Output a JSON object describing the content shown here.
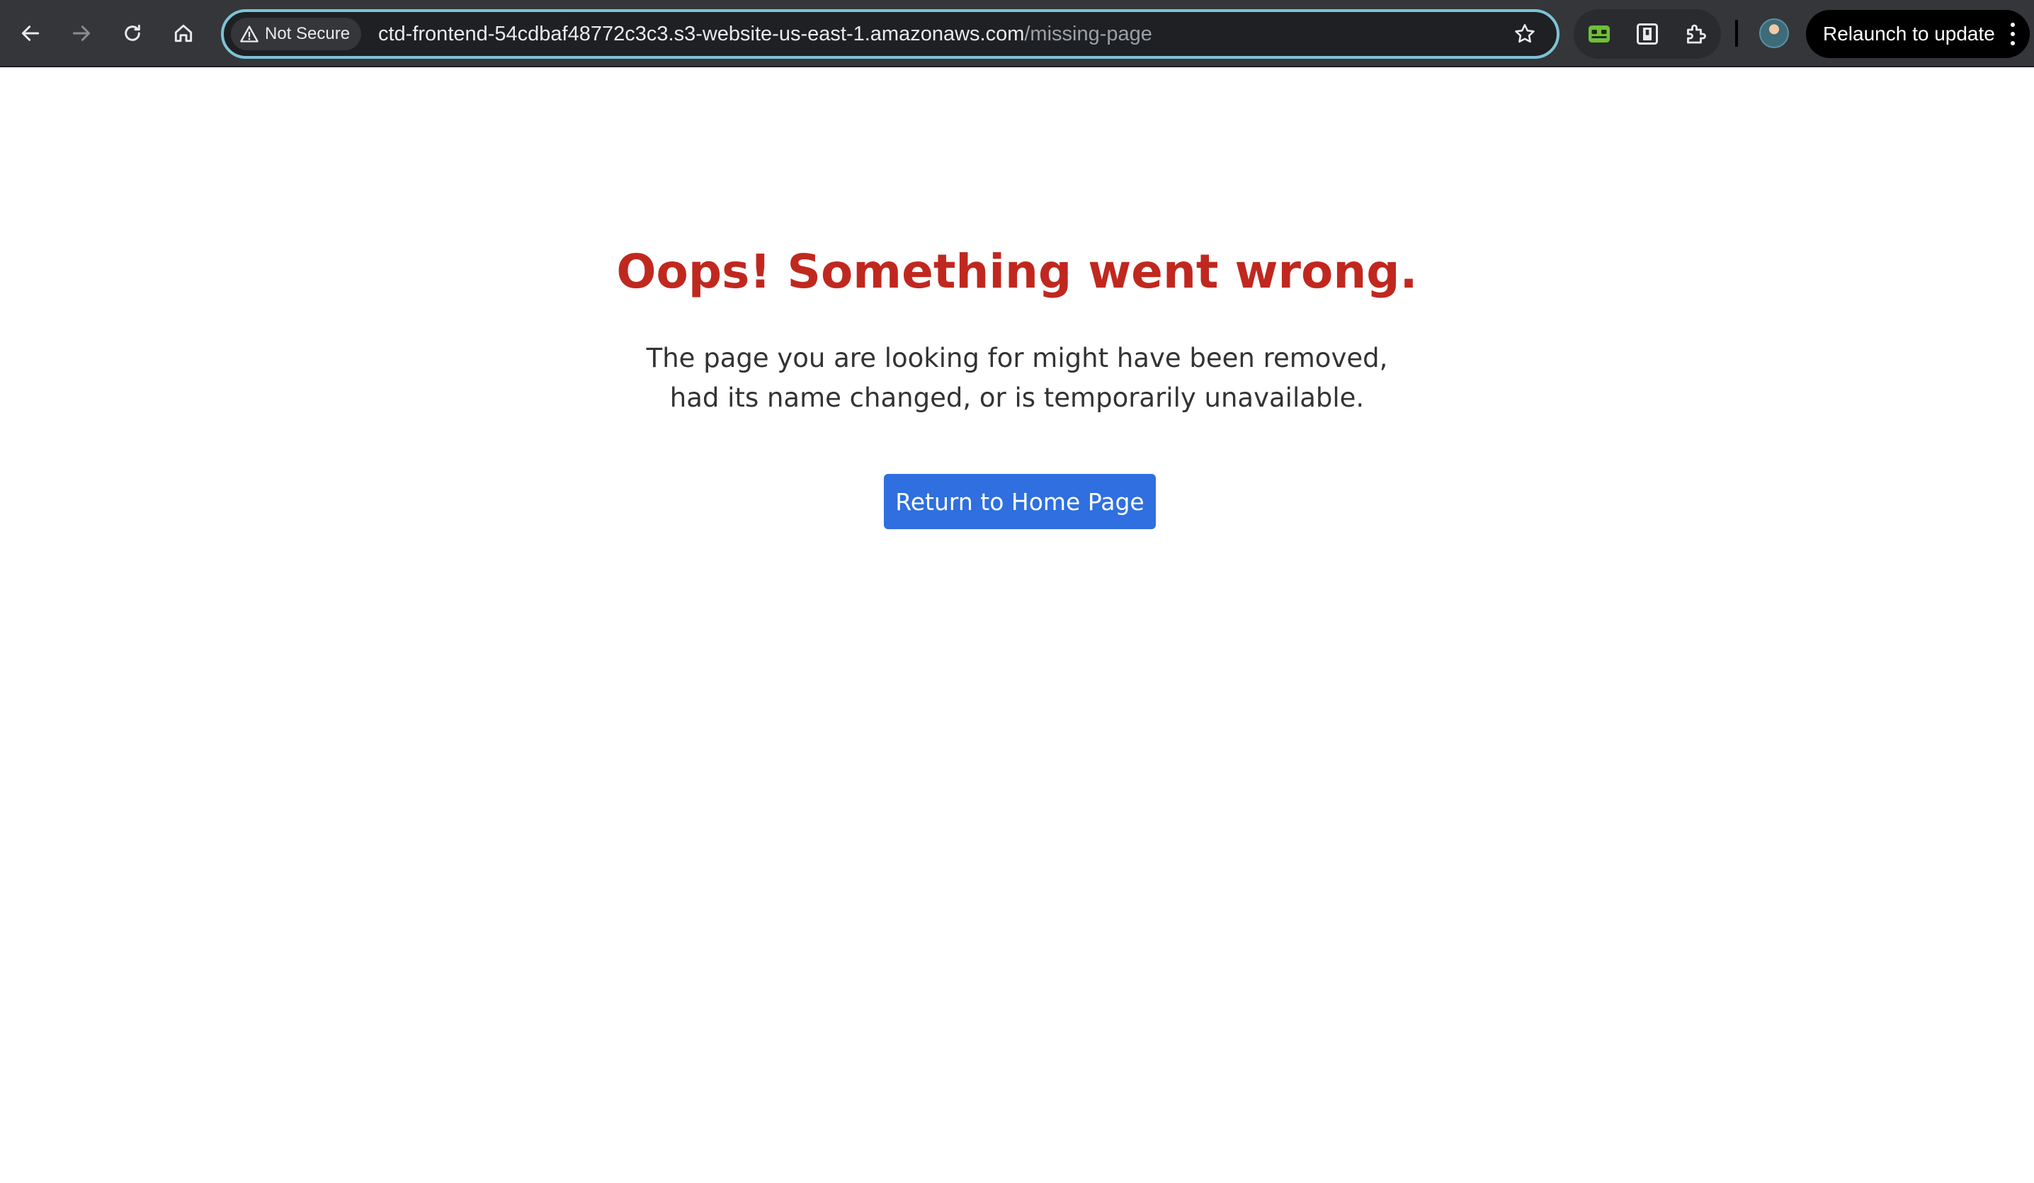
{
  "browser": {
    "security_chip": "Not Secure",
    "url_host": "ctd-frontend-54cdbaf48772c3c3.s3-website-us-east-1.amazonaws.com",
    "url_path": "/missing-page",
    "relaunch_label": "Relaunch to update",
    "icons": {
      "back": "back-arrow-icon",
      "forward": "forward-arrow-icon",
      "reload": "reload-icon",
      "home": "home-icon",
      "warning": "warning-icon",
      "bookmark": "star-icon",
      "extensions": [
        "green-extension-icon",
        "page-extension-icon",
        "puzzle-icon"
      ],
      "menu": "kebab-menu-icon"
    },
    "colors": {
      "toolbar": "#35363a",
      "omnibox_border": "#7cc4d6",
      "relaunch_bg": "#000000"
    }
  },
  "page": {
    "title": "Oops! Something went wrong.",
    "message": "The page you are looking for might have been removed, had its name changed, or is temporarily unavailable.",
    "button_label": "Return to Home Page",
    "colors": {
      "title": "#c0281f",
      "button": "#2f6fdf"
    }
  }
}
